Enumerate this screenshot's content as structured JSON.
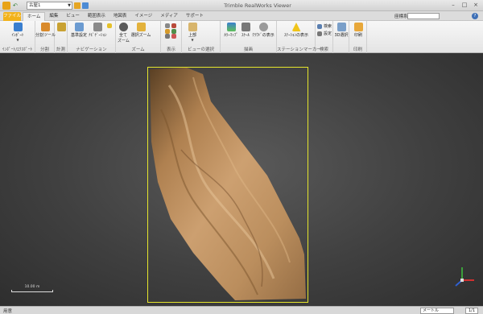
{
  "window": {
    "title": "Trimble RealWorks Viewer",
    "view_select": "古屋1",
    "controls": {
      "minimize": "–",
      "maximize": "□",
      "close": "×"
    }
  },
  "tabs": {
    "file": "ファイル",
    "items": [
      "ホーム",
      "編集",
      "ビュー",
      "範囲表示",
      "地図表",
      "イメージ",
      "メディア",
      "サポート"
    ],
    "active": "ホーム",
    "coord_label": "座標系",
    "coord_value": "",
    "help": "?"
  },
  "ribbon": {
    "import": {
      "import_label": "ｲﾝﾎﾟｰﾄ",
      "group": "ｲﾝﾎﾟｰﾄ/ｴｸｽﾎﾟｰﾄ"
    },
    "split": {
      "split_label": "分割ツール",
      "group": "分割"
    },
    "measure": {
      "group": "計測"
    },
    "navigation": {
      "base_label": "基準設定",
      "navigate_label": "ﾅﾋﾞｹﾞｰｼｮﾝ",
      "group": "ナビゲーション"
    },
    "zoom": {
      "all_label": "全て",
      "all_label2": "ズーム",
      "select_label": "選択ズーム",
      "group": "ズーム"
    },
    "display": {
      "group": "表示"
    },
    "viewpoint": {
      "top_label": "上部",
      "group": "ビューの選択"
    },
    "render": {
      "color_label": "ｶﾗｰﾏｯﾌﾟ",
      "scale_label": "ｽｹｰﾙ",
      "cloud_label": "ｸﾗｳﾄﾞの表示",
      "group": "描画"
    },
    "station": {
      "show_label": "ｽﾃｰｼｮﾝの表示",
      "group": "ステーションマーカー"
    },
    "search": {
      "search_label": "検索",
      "settings_label": "設定",
      "group": "検索"
    },
    "select3d": {
      "label": "3D選択",
      "group": ""
    },
    "print": {
      "label": "印刷",
      "group": "印刷"
    }
  },
  "viewport": {
    "scale_text": "10.00 m"
  },
  "status": {
    "text": "用意",
    "unit": "メートル",
    "zoom": "1/1"
  },
  "colors": {
    "accent_file_tab": "#f2b21a",
    "bbox": "#e6e62c",
    "viewport_bg": "#404040"
  }
}
